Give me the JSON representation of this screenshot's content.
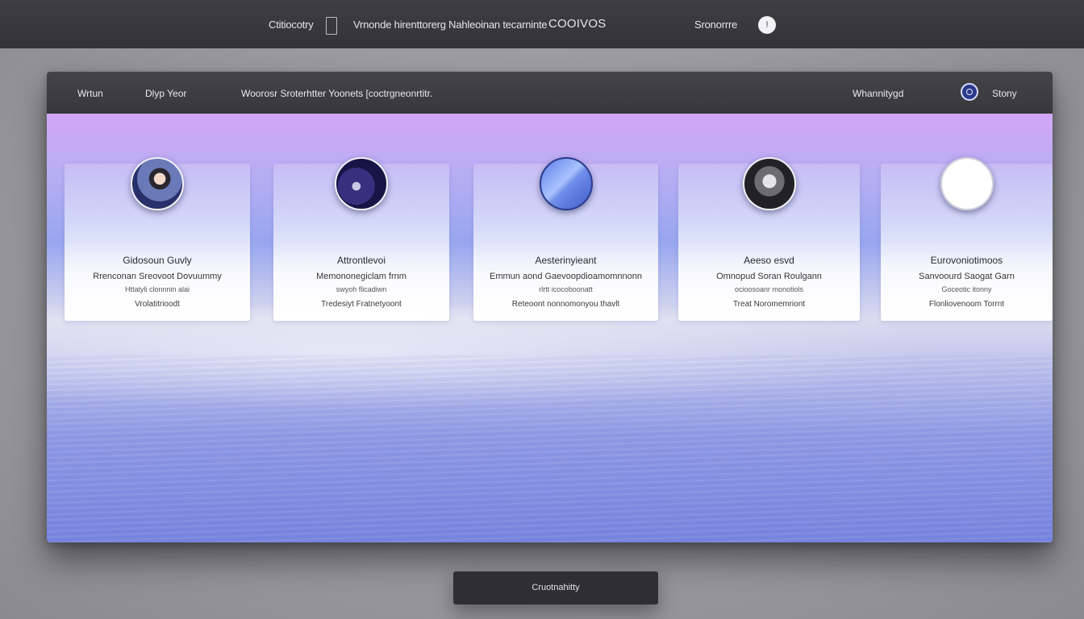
{
  "topbar": {
    "left_label": "Ctitiocotry",
    "middle_label": "Vrnonde hirenttorerg Nahleoinan tecarninte",
    "brand": "COOIVOS",
    "right_label": "Sronorrre",
    "action_glyph": "!"
  },
  "window": {
    "nav_1": "Wrtun",
    "nav_2": "Dlyp Yeor",
    "description": "Woorosr Sroterhtter Yoonets [coctrgneonrtitr.",
    "right_label_1": "Whannitygd",
    "right_label_2": "Stony"
  },
  "cards": [
    {
      "name": "Gidosoun Guvly",
      "line1": "Rrenconan Sreovoot Dovuummy",
      "line2": "Httatyli clonnnin alai",
      "line3": "Vrolatitrioodt",
      "avatar_icon": "person-photo-icon"
    },
    {
      "name": "Attrontlevoi",
      "line1": "Memononegiclam frnm",
      "line2": "swyoh flicadiwn",
      "line3": "Tredesiyt Fratnetyoont",
      "avatar_icon": "abstract-photo-icon"
    },
    {
      "name": "Aesterinyieant",
      "line1": "Emmun aond Gaevoopdioamomnnonn",
      "line2": "rlrtt icocoboonatt",
      "line3": "Reteoont nonnomonyou thavlt",
      "avatar_icon": "blue-glass-icon"
    },
    {
      "name": "Aeeso esvd",
      "line1": "Omnopud Soran Roulgann",
      "line2": "ocioosoanr monotiols",
      "line3": "Treat Noromemriont",
      "avatar_icon": "portrait-photo-icon"
    },
    {
      "name": "Eurovoniotimoos",
      "line1": "Sanvoourd Saogat Garn",
      "line2": "Goceotic itonny",
      "line3": "Flonliovenoom Torrnt",
      "avatar_icon": "blank-avatar-icon"
    }
  ],
  "bottom_button": "Cruotnahitty",
  "colors": {
    "topbar": "#38383a",
    "stage_top": "#d3a6f5",
    "stage_bottom": "#7785de",
    "button": "#2f2f31"
  }
}
